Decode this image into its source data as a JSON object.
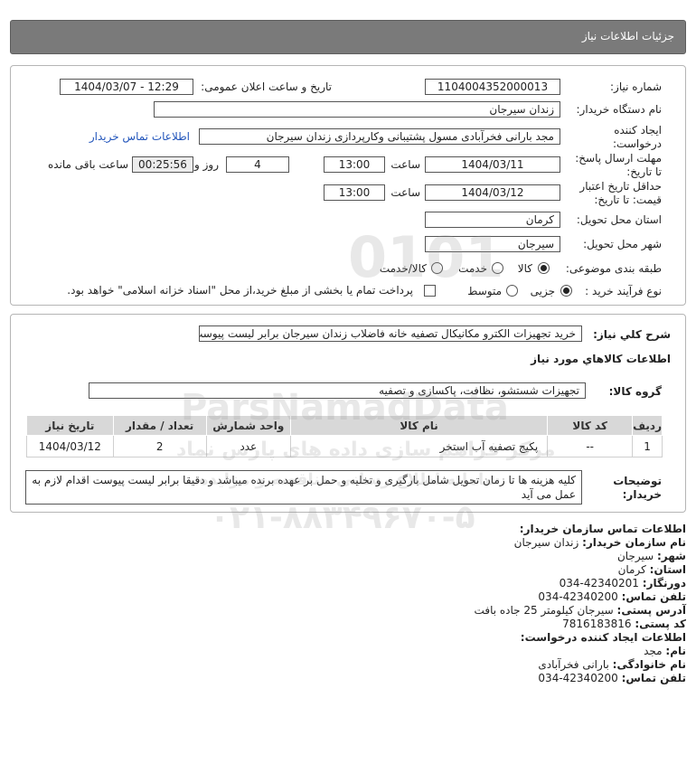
{
  "header": {
    "title": "جزئیات اطلاعات نیاز"
  },
  "form": {
    "need_number_label": "شماره نیاز:",
    "need_number": "1104004352000013",
    "announce_label": "تاریخ و ساعت اعلان عمومی:",
    "announce_value": "1404/03/07 - 12:29",
    "buyer_org_label": "نام دستگاه خریدار:",
    "buyer_org": "زندان سیرجان",
    "creator_label_1": "ایجاد کننده",
    "creator_label_2": "درخواست:",
    "creator": "مجد بارانی فخرآبادی مسول پشتیبانی وکارپردازی زندان سیرجان",
    "contact_link": "اطلاعات تماس خریدار",
    "reply_label_1": "مهلت ارسال پاسخ:",
    "reply_label_2": "تا تاریخ:",
    "reply_date": "1404/03/11",
    "time_label": "ساعت",
    "reply_time": "13:00",
    "days": "4",
    "days_label": "روز و",
    "remaining": "00:25:56",
    "remaining_label": "ساعت باقی مانده",
    "validity_label_1": "حداقل تاریخ اعتبار",
    "validity_label_2": "قیمت: تا تاریخ:",
    "validity_date": "1404/03/12",
    "validity_time": "13:00",
    "province_label": "استان محل تحویل:",
    "province": "کرمان",
    "city_label": "شهر محل تحویل:",
    "city": "سیرجان",
    "category_label": "طبقه بندی موضوعی:",
    "category_options": [
      "کالا",
      "خدمت",
      "کالا/خدمت"
    ],
    "process_label": "نوع فرآیند خرید :",
    "process_options": [
      "جزیی",
      "متوسط"
    ],
    "payment_text": "پرداخت تمام یا بخشی از مبلغ خرید،از محل \"اسناد خزانه اسلامی\" خواهد بود."
  },
  "summary": {
    "label": "شرح كلي نياز:",
    "value": "خرید تجهیزات الکترو مکانیکال تصفیه خانه فاضلاب زندان سیرجان برابر لیست پیوست"
  },
  "goods": {
    "heading": "اطلاعات كالاهاي مورد نياز",
    "group_label": "گروه کالا:",
    "group_value": "تجهیزات شستشو، نظافت، پاکسازی و تصفیه",
    "columns": [
      "ردیف",
      "کد کالا",
      "نام کالا",
      "واحد شمارش",
      "تعداد / مقدار",
      "تاریخ نیاز"
    ],
    "rows": [
      [
        "1",
        "--",
        "پکیج تصفیه آب استخر",
        "عدد",
        "2",
        "1404/03/12"
      ]
    ]
  },
  "notes": {
    "label_1": "توضیحات",
    "label_2": "خریدار:",
    "text": "کلیه هزینه ها تا زمان تحویل شامل بارگیری و تخلیه و حمل بر عهده برنده میباشد و دقیقا برابر لیست پیوست اقدام لازم به عمل می آید"
  },
  "contact": {
    "title": "اطلاعات تماس سازمان خریدار:",
    "org_label": "نام سازمان خریدار:",
    "org": "زندان سیرجان",
    "city_label": "شهر:",
    "city": "سیرجان",
    "province_label": "استان:",
    "province": "کرمان",
    "fax_label": "دورنگار:",
    "fax": "034-42340201",
    "phone_label": "تلفن تماس:",
    "phone": "034-42340200",
    "address_label": "آدرس پستی:",
    "address": "سیرجان کیلومتر 25 جاده بافت",
    "postal_label": "کد پستی:",
    "postal": "7816183816",
    "creator_title": "اطلاعات ایجاد کننده درخواست:",
    "name_label": "نام:",
    "name": "مجد",
    "family_label": "نام خانوادگی:",
    "family": "بارانی فخرآبادی",
    "creator_phone_label": "تلفن تماس:",
    "creator_phone": "034-42340200"
  },
  "watermark": {
    "number": "0101",
    "brand": "ParsNamadData",
    "persian": "مرکز فراهم سازی داده های پارس نماد",
    "sub": "سامانه اطلاع رسانی مناقصه و مزایده",
    "phone": "۰۲۱-۸۸۳۴۹۶۷۰-۵"
  },
  "colors": {
    "header_bg": "#7a7a7a",
    "link": "#2255bb",
    "table_header": "#d8d8d8"
  }
}
